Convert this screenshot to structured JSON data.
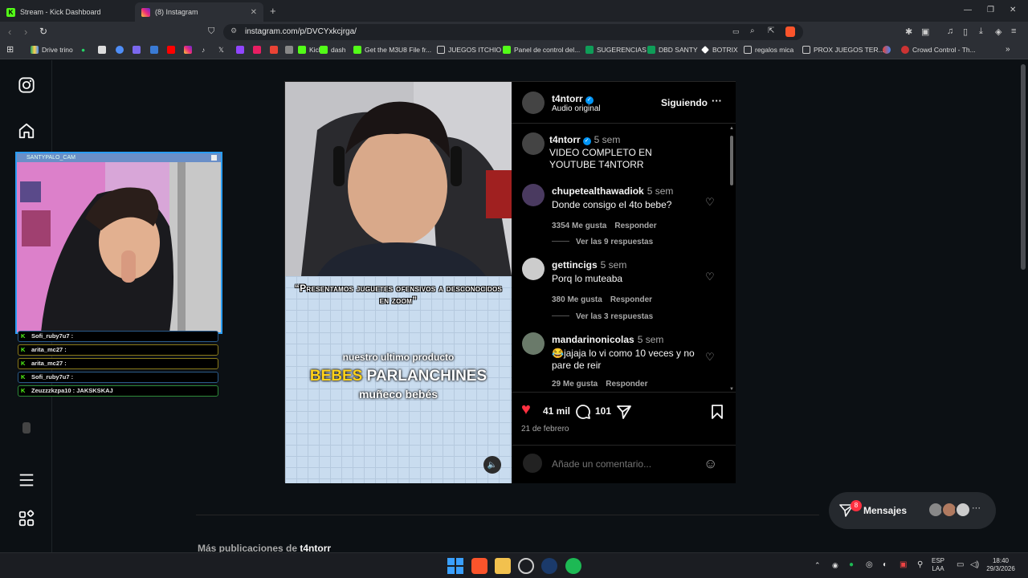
{
  "browser": {
    "tabs": [
      {
        "title": "Stream - Kick Dashboard",
        "icon": "kick-icon"
      },
      {
        "title": "(8) Instagram",
        "icon": "instagram-icon"
      }
    ],
    "url": "instagram.com/p/DVCYxkcjrga/",
    "bookmarks": [
      {
        "label": "Drive trino",
        "icon": "drive-icon"
      },
      {
        "label": "Kick",
        "icon": "kick-icon"
      },
      {
        "label": "dash",
        "icon": "kick-icon"
      },
      {
        "label": "Get the M3U8 File fr...",
        "icon": "kick-icon"
      },
      {
        "label": "JUEGOS ITCHIO",
        "icon": "folder-icon"
      },
      {
        "label": "Panel de control del...",
        "icon": "kick-icon"
      },
      {
        "label": "SUGERENCIAS",
        "icon": "sheets-icon"
      },
      {
        "label": "DBD SANTY",
        "icon": "sheets-icon"
      },
      {
        "label": "BOTRIX",
        "icon": "botrix-icon"
      },
      {
        "label": "regalos mica",
        "icon": "folder-icon"
      },
      {
        "label": "PROX JUEGOS TER...",
        "icon": "folder-icon"
      },
      {
        "label": "Crowd Control - Th...",
        "icon": "crowd-control-icon"
      }
    ]
  },
  "overlay": {
    "cam_title": "SANTYPALO_CAM",
    "chat": [
      {
        "text": "Sofi_ruby7u7 :",
        "style": "blue"
      },
      {
        "text": "arita_mc27 :",
        "style": "yellow"
      },
      {
        "text": "arita_mc27 :",
        "style": "yellow"
      },
      {
        "text": "Sofi_ruby7u7 :",
        "style": "blue"
      },
      {
        "text": "Zeuzzzkzpa10 : JAKSKSKAJ",
        "style": "green"
      }
    ]
  },
  "post": {
    "video": {
      "quote": "“Presentamos juguetes ofensivos a desconocidos en zoom”",
      "caption_line1": "nuestro ultimo producto",
      "caption_highlight": "BEBES",
      "caption_rest": "PARLANCHINES",
      "caption_line3": "muñeco bebés"
    },
    "author": {
      "username": "t4ntorr",
      "audio": "Audio original",
      "follow_label": "Siguiendo"
    },
    "caption": {
      "username": "t4ntorr",
      "time": "5 sem",
      "text": "VIDEO COMPLETO EN YOUTUBE T4NTORR"
    },
    "comments": [
      {
        "username": "chupetealthawadiok",
        "time": "5 sem",
        "text": "Donde consigo el 4to bebe?",
        "likes": "3354 Me gusta",
        "reply": "Responder",
        "replies": "Ver las 9 respuestas"
      },
      {
        "username": "gettincigs",
        "time": "5 sem",
        "text": "Porq lo muteaba",
        "likes": "380 Me gusta",
        "reply": "Responder",
        "replies": "Ver las 3 respuestas"
      },
      {
        "username": "mandarinonicolas",
        "time": "5 sem",
        "text": "😂jajaja lo vi como 10 veces y no pare de reir",
        "likes": "29 Me gusta",
        "reply": "Responder",
        "replies": ""
      }
    ],
    "likes": "41 mil",
    "comment_count": "101",
    "date": "21 de febrero",
    "add_comment_placeholder": "Añade un comentario..."
  },
  "more_posts": {
    "prefix": "Más publicaciones de",
    "username": "t4ntorr"
  },
  "messages": {
    "label": "Mensajes",
    "badge": "8"
  },
  "taskbar": {
    "lang1": "ESP",
    "lang2": "LAA",
    "time": "18:40",
    "date": "29/3/2026"
  },
  "colors": {
    "accent": "#0095f6",
    "like": "#ff3040",
    "kick": "#53fc18",
    "caption_yellow": "#ffd21a"
  }
}
